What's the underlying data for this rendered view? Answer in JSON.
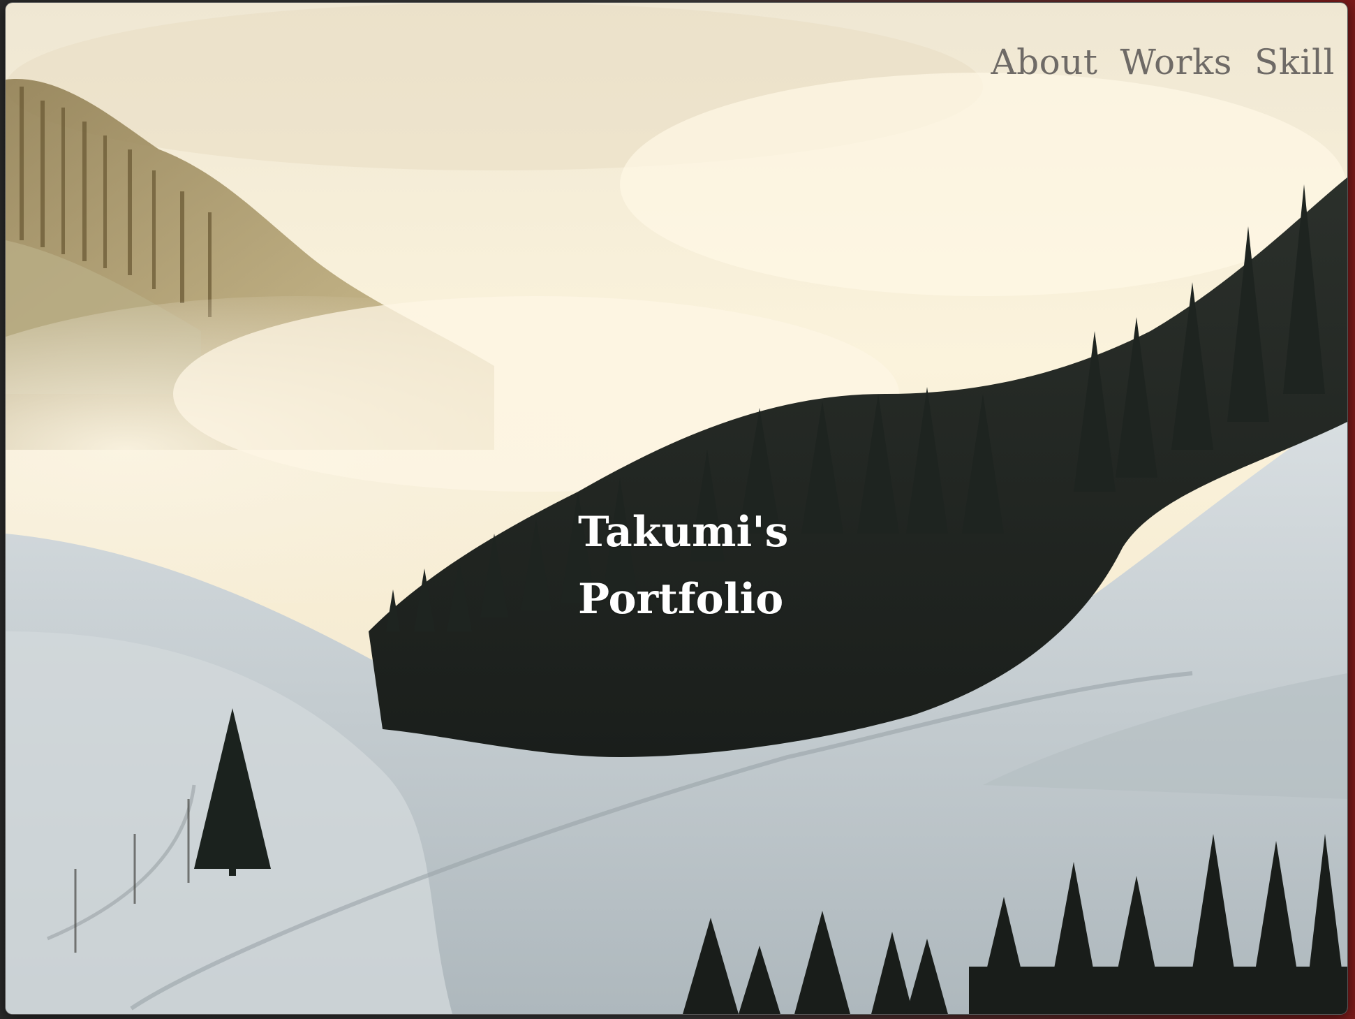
{
  "nav": {
    "items": [
      {
        "label": "About"
      },
      {
        "label": "Works"
      },
      {
        "label": "Skill"
      }
    ]
  },
  "hero": {
    "title_line1": "Takumi's",
    "title_line2": "Portfolio",
    "background": "foggy-snowy-hillside-forest-photo"
  },
  "colors": {
    "nav_text": "#6e6a66",
    "title_text": "#ffffff",
    "sky": "#f6ecd2",
    "snow": "#c9d3d8",
    "forest": "#1c2320"
  }
}
